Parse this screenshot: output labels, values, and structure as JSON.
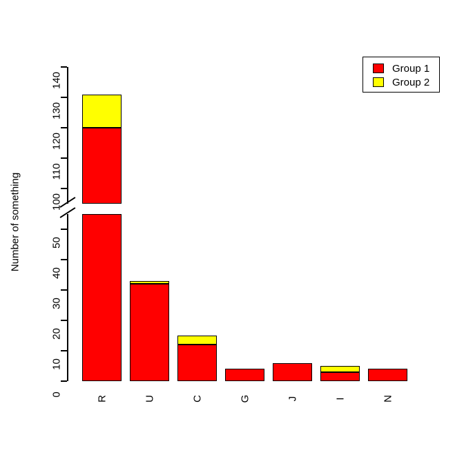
{
  "chart_data": {
    "type": "bar",
    "title": "",
    "subtitle": "",
    "xlabel": "",
    "ylabel": "Number of something",
    "stacked": true,
    "grid": false,
    "axis_break": {
      "present": true,
      "lower_range": [
        0,
        55
      ],
      "upper_range": [
        95,
        140
      ]
    },
    "ylim": [
      0,
      140
    ],
    "ytick_labels": [
      "0",
      "10",
      "20",
      "30",
      "40",
      "50",
      "100",
      "110",
      "120",
      "130",
      "140"
    ],
    "ytick_values": [
      0,
      10,
      20,
      30,
      40,
      50,
      100,
      110,
      120,
      130,
      140
    ],
    "categories": [
      "R",
      "U",
      "C",
      "G",
      "J",
      "I",
      "N"
    ],
    "series": [
      {
        "name": "Group 1",
        "color": "#ff0000",
        "values": [
          120,
          32,
          12,
          4,
          6,
          3,
          4
        ]
      },
      {
        "name": "Group 2",
        "color": "#ffff00",
        "values": [
          11,
          1,
          3,
          0,
          0,
          2,
          0
        ]
      }
    ],
    "totals": [
      131,
      33,
      15,
      4,
      6,
      5,
      4
    ],
    "legend": {
      "position": "top-right",
      "entries": [
        {
          "label": "Group 1",
          "color": "#ff0000"
        },
        {
          "label": "Group 2",
          "color": "#ffff00"
        }
      ]
    }
  },
  "colors": {
    "group1": "#ff0000",
    "group2": "#ffff00",
    "axis": "#000000",
    "background": "#ffffff"
  }
}
